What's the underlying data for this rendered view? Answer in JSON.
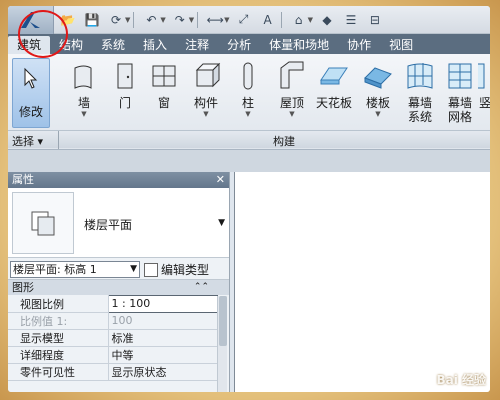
{
  "tabs": [
    "建筑",
    "结构",
    "系统",
    "插入",
    "注释",
    "分析",
    "体量和场地",
    "协作",
    "视图"
  ],
  "ribbon": {
    "modify_label": "修改",
    "tools": [
      {
        "label": "墙",
        "icon": "wall-icon",
        "caret": true
      },
      {
        "label": "门",
        "icon": "door-icon",
        "caret": false
      },
      {
        "label": "窗",
        "icon": "window-icon",
        "caret": false
      },
      {
        "label": "构件",
        "icon": "component-icon",
        "caret": true
      },
      {
        "label": "柱",
        "icon": "column-icon",
        "caret": true
      },
      {
        "label": "屋顶",
        "icon": "roof-icon",
        "caret": true
      },
      {
        "label": "天花板",
        "icon": "ceiling-icon",
        "caret": false
      },
      {
        "label": "楼板",
        "icon": "floor-icon",
        "caret": true
      },
      {
        "label": "幕墙\n系统",
        "icon": "curtain-system-icon",
        "caret": false
      },
      {
        "label": "幕墙\n网格",
        "icon": "curtain-grid-icon",
        "caret": false
      },
      {
        "label": "竖",
        "icon": "mullion-icon",
        "caret": false
      }
    ],
    "group_select": "选择 ▾",
    "group_build": "构建"
  },
  "properties": {
    "title": "属性",
    "close": "✕",
    "type_name": "楼层平面",
    "filter": "楼层平面: 标高 1",
    "edit_type": "编辑类型",
    "section": "图形",
    "section_toggle": "⌃⌃",
    "rows": [
      {
        "key": "视图比例",
        "value": "1 : 100",
        "boxed": true,
        "dim": false
      },
      {
        "key": "比例值 1:",
        "value": "100",
        "boxed": false,
        "dim": true
      },
      {
        "key": "显示模型",
        "value": "标准",
        "boxed": false,
        "dim": false
      },
      {
        "key": "详细程度",
        "value": "中等",
        "boxed": false,
        "dim": false
      },
      {
        "key": "零件可见性",
        "value": "显示原状态",
        "boxed": false,
        "dim": false
      }
    ]
  },
  "watermark": "Bai 经验",
  "colors": {
    "accent": "#5b6d80",
    "highlight": "#e01818"
  }
}
